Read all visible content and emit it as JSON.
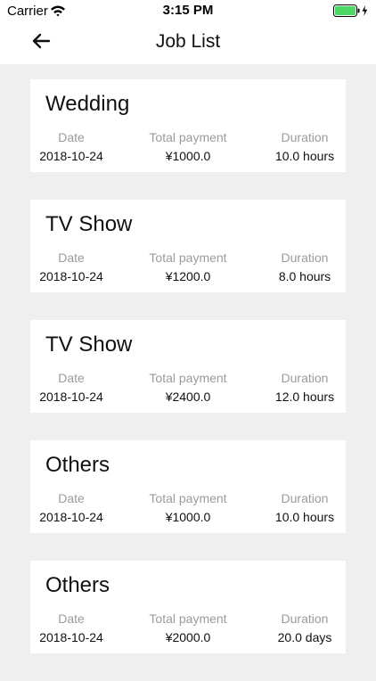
{
  "status_bar": {
    "carrier": "Carrier",
    "time": "3:15 PM",
    "battery_color": "#4cd964"
  },
  "nav": {
    "title": "Job List",
    "back_icon": "arrow-left-icon"
  },
  "labels": {
    "date": "Date",
    "payment": "Total payment",
    "duration": "Duration"
  },
  "jobs": [
    {
      "title": "Wedding",
      "date": "2018-10-24",
      "payment": "¥1000.0",
      "duration": "10.0 hours"
    },
    {
      "title": "TV Show",
      "date": "2018-10-24",
      "payment": "¥1200.0",
      "duration": "8.0 hours"
    },
    {
      "title": "TV Show",
      "date": "2018-10-24",
      "payment": "¥2400.0",
      "duration": "12.0 hours"
    },
    {
      "title": "Others",
      "date": "2018-10-24",
      "payment": "¥1000.0",
      "duration": "10.0 hours"
    },
    {
      "title": "Others",
      "date": "2018-10-24",
      "payment": "¥2000.0",
      "duration": "20.0 days"
    }
  ]
}
